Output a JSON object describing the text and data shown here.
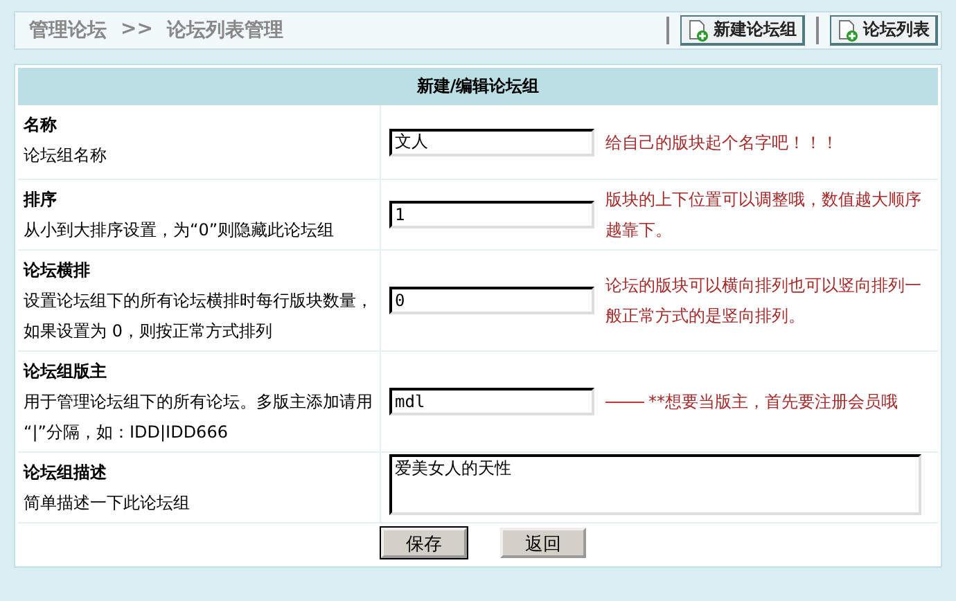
{
  "breadcrumb": {
    "root": "管理论坛",
    "separator": ">>",
    "current": "论坛列表管理"
  },
  "toolbar": [
    {
      "label": "新建论坛组"
    },
    {
      "label": "论坛列表"
    }
  ],
  "form": {
    "title": "新建/编辑论坛组",
    "rows": [
      {
        "kind": "input",
        "label": "名称",
        "description": "论坛组名称",
        "value": "文人",
        "hint": "给自己的版块起个名字吧！！！"
      },
      {
        "kind": "input",
        "label": "排序",
        "description": "从小到大排序设置，为“0”则隐藏此论坛组",
        "value": "1",
        "hint": "版块的上下位置可以调整哦，数值越大顺序越靠下。"
      },
      {
        "kind": "input",
        "label": "论坛横排",
        "description": "设置论坛组下的所有论坛横排时每行版块数量，如果设置为 0，则按正常方式排列",
        "value": "0",
        "hint": "论坛的版块可以横向排列也可以竖向排列一般正常方式的是竖向排列。"
      },
      {
        "kind": "input",
        "label": "论坛组版主",
        "description": "用于管理论坛组下的所有论坛。多版主添加请用 “|”分隔，如：IDD|IDD666",
        "value": "mdl",
        "hint": "**想要当版主，首先要注册会员哦",
        "leader": true
      },
      {
        "kind": "textarea",
        "label": "论坛组描述",
        "description": "简单描述一下此论坛组",
        "value": "爱美女人的天性"
      }
    ],
    "buttons": [
      {
        "label": "保存",
        "default": true
      },
      {
        "label": "返回",
        "default": false
      }
    ]
  }
}
